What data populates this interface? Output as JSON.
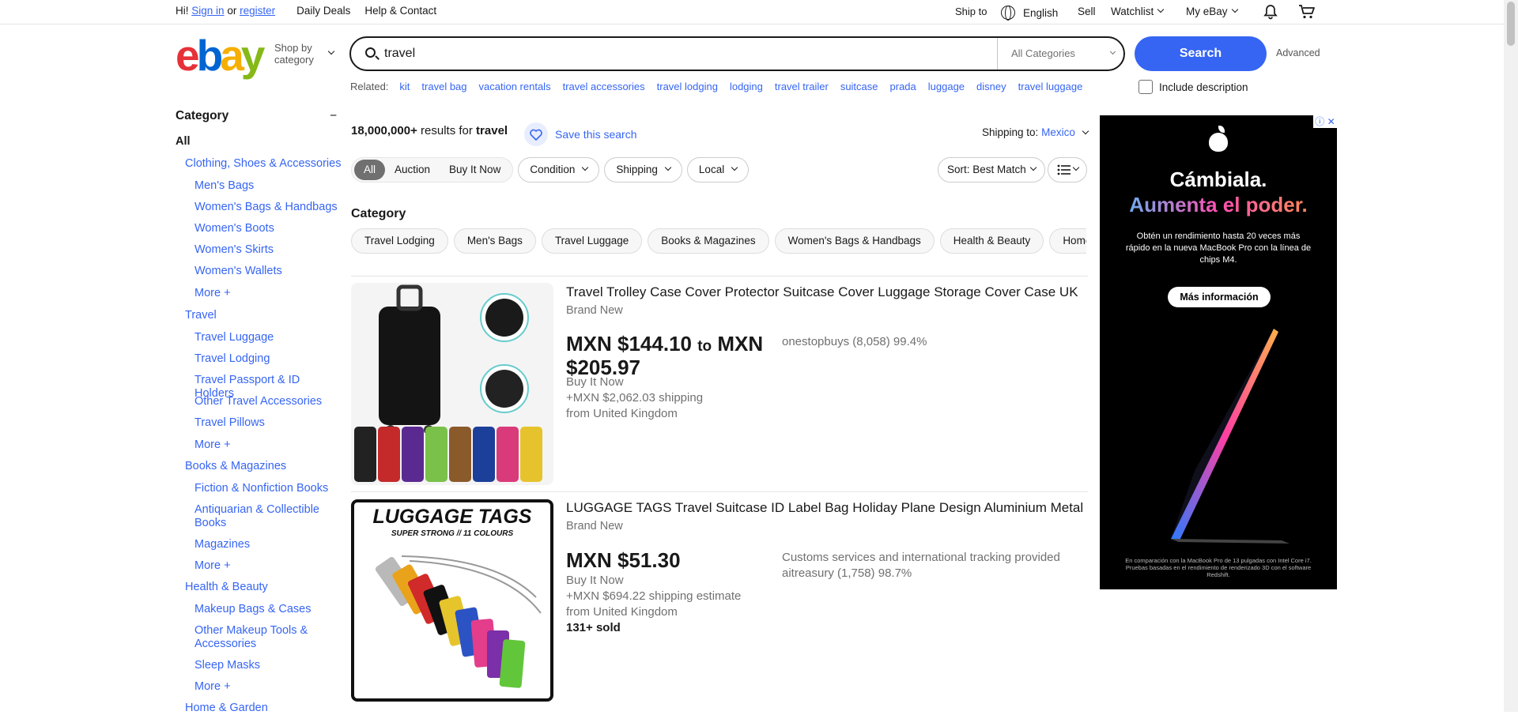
{
  "topbar": {
    "greeting": "Hi!",
    "sign_in": "Sign in",
    "or": "or",
    "register": "register",
    "daily_deals": "Daily Deals",
    "help": "Help & Contact",
    "ship_to": "Ship to",
    "language": "English",
    "sell": "Sell",
    "watchlist": "Watchlist",
    "my_ebay": "My eBay"
  },
  "header": {
    "logo_e": "e",
    "logo_b": "b",
    "logo_a": "a",
    "logo_y": "y",
    "shop_by_1": "Shop by",
    "shop_by_2": "category",
    "search_value": "travel",
    "category_select": "All Categories",
    "search_button": "Search",
    "advanced": "Advanced"
  },
  "related": {
    "label": "Related:",
    "items": [
      "kit",
      "travel bag",
      "vacation rentals",
      "travel accessories",
      "travel lodging",
      "lodging",
      "travel trailer",
      "suitcase",
      "prada",
      "luggage",
      "disney",
      "travel luggage"
    ],
    "include_description": "Include description"
  },
  "sidebar": {
    "title": "Category",
    "collapse": "−",
    "all": "All",
    "items": [
      "Clothing, Shoes & Accessories",
      "Men's Bags",
      "Women's Bags & Handbags",
      "Women's Boots",
      "Women's Skirts",
      "Women's Wallets",
      "More +",
      "Travel",
      "Travel Luggage",
      "Travel Lodging",
      "Travel Passport & ID Holders",
      "Other Travel Accessories",
      "Travel Pillows",
      "More +",
      "Books & Magazines",
      "Fiction & Nonfiction Books",
      "Antiquarian & Collectible",
      "Books",
      "Magazines",
      "More +",
      "Health & Beauty",
      "Makeup Bags & Cases",
      "Other Makeup Tools &",
      "Accessories",
      "Sleep Masks",
      "More +",
      "Home & Garden"
    ]
  },
  "results": {
    "count": "18,000,000+",
    "results_for": "results for",
    "query": "travel",
    "save_search": "Save this search",
    "shipping_to_label": "Shipping to:",
    "shipping_to_country": "Mexico"
  },
  "filters": {
    "buying_format": [
      "All",
      "Auction",
      "Buy It Now"
    ],
    "dropdowns": [
      "Condition",
      "Shipping",
      "Local"
    ],
    "sort": "Sort: Best Match"
  },
  "category_pills": {
    "title": "Category",
    "items": [
      "Travel Lodging",
      "Men's Bags",
      "Travel Luggage",
      "Books & Magazines",
      "Women's Bags & Handbags",
      "Health & Beauty",
      "Home & Garden"
    ]
  },
  "listings": [
    {
      "title": "Travel Trolley Case Cover Protector Suitcase Cover Luggage Storage Cover Case UK",
      "condition": "Brand New",
      "price_low": "MXN $144.10",
      "price_to": "to",
      "price_high_1": "MXN",
      "price_high_2": "$205.97",
      "format": "Buy It Now",
      "shipping": "+MXN $2,062.03 shipping",
      "location": "from United Kingdom",
      "seller": "onestopbuys (8,058) 99.4%"
    },
    {
      "title": "LUGGAGE TAGS Travel Suitcase ID Label Bag Holiday Plane Design Aluminium Metal",
      "condition": "Brand New",
      "price": "MXN $51.30",
      "format": "Buy It Now",
      "shipping": "+MXN $694.22 shipping estimate",
      "location": "from United Kingdom",
      "sold": "131+ sold",
      "seller_note": "Customs services and international tracking provided",
      "seller": "aitreasury (1,758) 98.7%",
      "image_headline": "LUGGAGE TAGS",
      "image_subline": "SUPER STRONG // 11 COLOURS"
    }
  ],
  "ad": {
    "headline_1": "Cámbiala.",
    "headline_2": "Aumenta el poder.",
    "body": "Obtén un rendimiento hasta 20 veces más rápido en la nueva MacBook Pro con la línea de chips M4.",
    "cta": "Más información",
    "footnote": "En comparación con la MacBook Pro de 13 pulgadas con Intel Core i7. Pruebas basadas en el rendimiento de renderizado 3D con el software Redshift.",
    "badge": "ⓘ ✕"
  },
  "colors": {
    "brand_blue": "#3665f3",
    "logo_red": "#e53238",
    "logo_blue": "#0064d2",
    "logo_yellow": "#f5af02",
    "logo_green": "#86b817"
  },
  "icons": [
    "globe-icon",
    "chevron-down-icon",
    "bell-icon",
    "cart-icon",
    "search-icon",
    "heart-icon",
    "list-view-icon",
    "apple-logo-icon"
  ]
}
